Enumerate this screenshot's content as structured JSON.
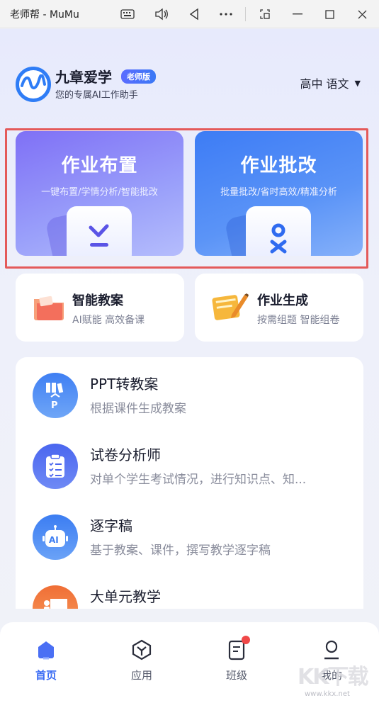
{
  "window": {
    "title": "老师帮 - MuMu",
    "controls": [
      "keyboard-icon",
      "volume-icon",
      "back-icon",
      "more-icon",
      "screenshot-icon",
      "minimize-icon",
      "maximize-icon",
      "close-icon"
    ]
  },
  "header": {
    "brand_name": "九章爱学",
    "badge": "老师版",
    "subtitle": "您的专属AI工作助手",
    "grade_subject": "高中 语文"
  },
  "primary_cards": [
    {
      "title": "作业布置",
      "subtitle": "一键布置/学情分析/智能批改",
      "icon": "download-icon"
    },
    {
      "title": "作业批改",
      "subtitle": "批量批改/省时高效/精准分析",
      "icon": "check-x-icon"
    }
  ],
  "secondary_cards": [
    {
      "title": "智能教案",
      "subtitle": "AI赋能 高效备课",
      "icon": "folder-icon"
    },
    {
      "title": "作业生成",
      "subtitle": "按需组题 智能组卷",
      "icon": "notebook-pencil-icon"
    }
  ],
  "tools": [
    {
      "title": "PPT转教案",
      "subtitle": "根据课件生成教案",
      "icon": "books-icon",
      "color": "#4a86f3"
    },
    {
      "title": "试卷分析师",
      "subtitle": "对单个学生考试情况，进行知识点、知...",
      "icon": "clipboard-icon",
      "color": "#4f6cf0"
    },
    {
      "title": "逐字稿",
      "subtitle": "基于教案、课件，撰写教学逐字稿",
      "icon": "ai-robot-icon",
      "color": "#3f7ff2"
    },
    {
      "title": "大单元教学",
      "subtitle": "",
      "icon": "teacher-board-icon",
      "color": "#f27a3c"
    }
  ],
  "bottom_nav": [
    {
      "label": "首页",
      "icon": "home-icon",
      "active": true
    },
    {
      "label": "应用",
      "icon": "apps-icon",
      "active": false
    },
    {
      "label": "班级",
      "icon": "class-icon",
      "active": false,
      "badge": "new"
    },
    {
      "label": "我的",
      "icon": "profile-icon",
      "active": false
    }
  ],
  "watermark": {
    "text": "KK下载",
    "url": "www.kkx.net"
  },
  "colors": {
    "accent": "#3a6cf4",
    "highlight_border": "#e45a5a"
  }
}
